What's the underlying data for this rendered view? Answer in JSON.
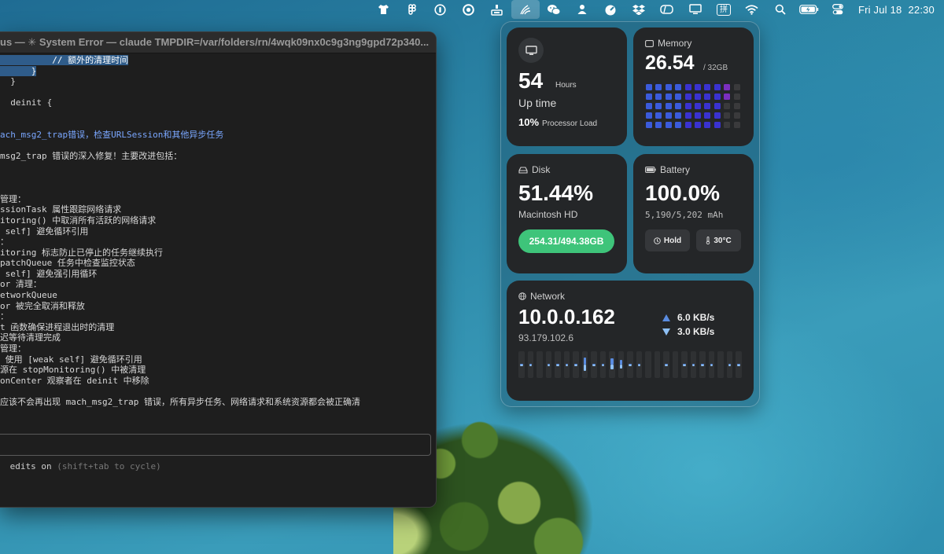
{
  "menubar": {
    "items": [
      {
        "name": "shirt-icon"
      },
      {
        "name": "figma-icon"
      },
      {
        "name": "one-password-icon"
      },
      {
        "name": "record-icon"
      },
      {
        "name": "dock-icon"
      },
      {
        "name": "stats-icon",
        "active": true
      },
      {
        "name": "wechat-icon"
      },
      {
        "name": "user-icon"
      },
      {
        "name": "speedometer-icon"
      },
      {
        "name": "dropbox-icon"
      },
      {
        "name": "cleanshot-icon"
      },
      {
        "name": "display-icon"
      },
      {
        "name": "input-method-icon",
        "label": "拼"
      },
      {
        "name": "wifi-icon"
      },
      {
        "name": "spotlight-icon"
      },
      {
        "name": "battery-icon"
      },
      {
        "name": "control-center-icon"
      }
    ],
    "day": "Fri Jul 18",
    "time": "22:30"
  },
  "terminal": {
    "title": "us — ✳ System Error — claude TMPDIR=/var/folders/rn/4wqk09nx0c9g3ng9gpd72p340...",
    "lines": [
      {
        "t": "          // 额外的清理时间",
        "hl": true
      },
      {
        "t": "      }",
        "hl": true
      },
      {
        "t": "  }"
      },
      {
        "t": ""
      },
      {
        "t": "  deinit {"
      },
      {
        "t": ""
      },
      {
        "t": ""
      },
      {
        "t": "ach_msg2_trap错误，检查URLSession和其他异步任务",
        "blue": true
      },
      {
        "t": ""
      },
      {
        "t": "msg2_trap 错误的深入修复！主要改进包括："
      },
      {
        "t": ""
      },
      {
        "t": ""
      },
      {
        "t": ""
      },
      {
        "t": "管理："
      },
      {
        "t": "ssionTask 属性跟踪网络请求"
      },
      {
        "t": "itoring() 中取消所有活跃的网络请求"
      },
      {
        "t": " self] 避免循环引用"
      },
      {
        "t": "："
      },
      {
        "t": "itoring 标志防止已停止的任务继续执行"
      },
      {
        "t": "patchQueue 任务中检查监控状态"
      },
      {
        "t": " self] 避免强引用循环"
      },
      {
        "t": "or 清理："
      },
      {
        "t": "etworkQueue"
      },
      {
        "t": "or 被完全取消和释放"
      },
      {
        "t": "："
      },
      {
        "t": "t 函数确保进程退出时的清理"
      },
      {
        "t": "迟等待清理完成"
      },
      {
        "t": "管理："
      },
      {
        "t": " 使用 [weak self] 避免循环引用"
      },
      {
        "t": "源在 stopMonitoring() 中被清理"
      },
      {
        "t": "onCenter 观察者在 deinit 中移除"
      },
      {
        "t": ""
      },
      {
        "t": "应该不会再出现 mach_msg2_trap 错误，所有异步任务、网络请求和系统资源都会被正确清"
      }
    ],
    "hint_main": " edits on ",
    "hint_dim": "(shift+tab to cycle)"
  },
  "stats": {
    "uptime": {
      "value": "54",
      "unit": "Hours",
      "label": "Up time",
      "load": "10%",
      "load_label": "Processor Load"
    },
    "memory": {
      "title": "Memory",
      "used": "26.54",
      "total": "/ 32GB",
      "used_fraction": 0.83
    },
    "disk": {
      "title": "Disk",
      "percent": "51.44%",
      "volume": "Macintosh HD",
      "usage": "254.31/494.38GB"
    },
    "battery": {
      "title": "Battery",
      "percent": "100.0%",
      "capacity": "5,190/5,202 mAh",
      "mode": "Hold",
      "temperature": "30°C"
    },
    "network": {
      "title": "Network",
      "local_ip": "10.0.0.162",
      "public_ip": "93.179.102.6",
      "upload": "6.0 KB/s",
      "download": "3.0 KB/s",
      "activity": [
        0.05,
        0.05,
        0,
        0.05,
        0.05,
        0.05,
        0.05,
        0.55,
        0.05,
        0.05,
        0.45,
        0.35,
        0.05,
        0.05,
        0,
        0,
        0.05,
        0,
        0.05,
        0.05,
        0.05,
        0.05,
        0,
        0.05,
        0.05
      ]
    },
    "colors": {
      "accent_blue": "#5a8ce0",
      "pill_green": "#3ec47a",
      "mem_blue": "#3b5bdb",
      "mem_purple": "#7b2fbf"
    }
  }
}
